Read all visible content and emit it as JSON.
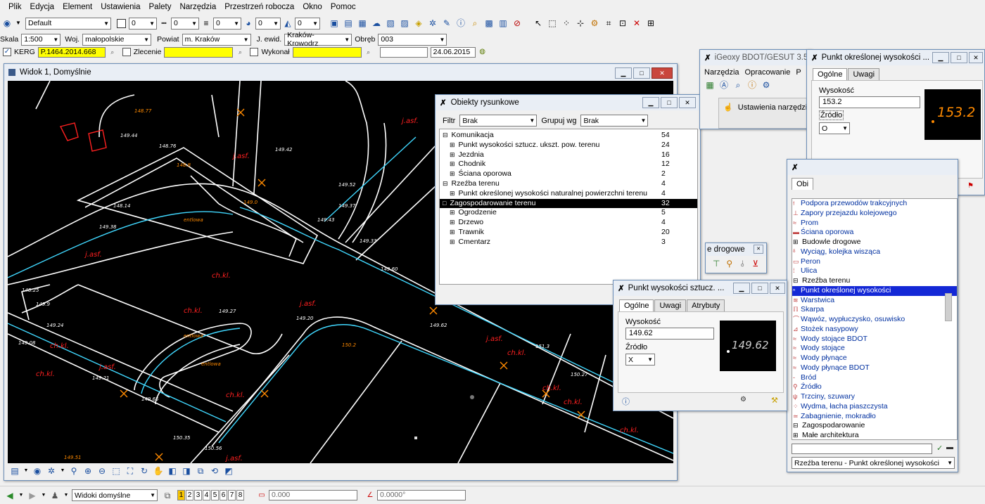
{
  "menu": [
    "Plik",
    "Edycja",
    "Element",
    "Ustawienia",
    "Palety",
    "Narzędzia",
    "Przestrzeń robocza",
    "Okno",
    "Pomoc"
  ],
  "toolbar1": {
    "style_combo": "Default",
    "color_val": "0",
    "weight_val": "0",
    "level_val": "0",
    "fill_val": "0",
    "trans_val": "0"
  },
  "toolbar2": {
    "skala_label": "Skala",
    "skala_value": "1:500",
    "woj_label": "Woj.",
    "woj_value": "małopolskie",
    "powiat_label": "Powiat",
    "powiat_value": "m. Kraków",
    "jewid_label": "J. ewid.",
    "jewid_value": "Kraków-Krowodrz",
    "obreb_label": "Obręb",
    "obreb_value": "003"
  },
  "toolbar3": {
    "kerg_label": "KERG",
    "kerg_value": "P.1464.2014.668",
    "zlecenie_label": "Zlecenie",
    "zlecenie_value": "",
    "wykonal_label": "Wykonał",
    "wykonal_value": "",
    "blank_value": "",
    "date_value": "24.06.2015"
  },
  "view_window": {
    "title": "Widok 1, Domyślnie"
  },
  "map_labels": {
    "heights": [
      "149.62",
      "149.0",
      "149.51",
      "149.44",
      "149.42",
      "149.43",
      "149.37",
      "149.33",
      "149.9",
      "148.8",
      "149.24",
      "149.27",
      "149.20",
      "149.60",
      "150.2",
      "151.3",
      "150.27",
      "150.35",
      "150.56",
      "149.62",
      "149.52",
      "149.21",
      "149.65",
      "148.14",
      "149.08",
      "148.25",
      "149.38",
      "148.77",
      "148.76"
    ],
    "jezd": [
      "j.asf.",
      "j.asf.",
      "j.asf.",
      "j.asf.",
      "j.asf.",
      "j.asf.",
      "j.asf."
    ],
    "chodnik": [
      "ch.kl.",
      "ch.kl.",
      "ch.kl.",
      "ch.kl.",
      "ch.kl.",
      "ch.kl.",
      "ch.kl.",
      "ch.kl.",
      "ch.kl."
    ],
    "entries": [
      "entlowa",
      "entlowa",
      "entlowa"
    ]
  },
  "obiekty": {
    "title": "Obiekty rysunkowe",
    "filtr_label": "Filtr",
    "filtr_value": "Brak",
    "grupuj_label": "Grupuj wg",
    "grupuj_value": "Brak",
    "rows": [
      {
        "label": "Komunikacja",
        "count": "54",
        "level": 0,
        "sel": false
      },
      {
        "label": "Punkt wysokości sztucz. ukszt. pow. terenu",
        "count": "24",
        "level": 1,
        "sel": false
      },
      {
        "label": "Jezdnia",
        "count": "16",
        "level": 1,
        "sel": false
      },
      {
        "label": "Chodnik",
        "count": "12",
        "level": 1,
        "sel": false
      },
      {
        "label": "Ściana oporowa",
        "count": "2",
        "level": 1,
        "sel": false
      },
      {
        "label": "Rzeźba terenu",
        "count": "4",
        "level": 0,
        "sel": false
      },
      {
        "label": "Punkt określonej wysokości naturalnej powierzchni terenu",
        "count": "4",
        "level": 1,
        "sel": false
      },
      {
        "label": "Zagospodarowanie terenu",
        "count": "32",
        "level": 0,
        "sel": true
      },
      {
        "label": "Ogrodzenie",
        "count": "5",
        "level": 1,
        "sel": false
      },
      {
        "label": "Drzewo",
        "count": "4",
        "level": 1,
        "sel": false
      },
      {
        "label": "Trawnik",
        "count": "20",
        "level": 1,
        "sel": false
      },
      {
        "label": "Cmentarz",
        "count": "3",
        "level": 1,
        "sel": false
      }
    ]
  },
  "punkt_sztuczny": {
    "title": "Punkt wysokości sztucz. ...",
    "tabs": [
      "Ogólne",
      "Uwagi",
      "Atrybuty"
    ],
    "wys_label": "Wysokość",
    "wys_value": "149.62",
    "zrodlo_label": "Źródło",
    "zrodlo_value": "X",
    "preview": "149.62"
  },
  "punkt_okreslony": {
    "title": "Punkt określonej wysokości ...",
    "tabs": [
      "Ogólne",
      "Uwagi"
    ],
    "wys_label": "Wysokość",
    "wys_value": "153.2",
    "zrodlo_label": "Źródło",
    "zrodlo_value": "O",
    "preview": "153.2"
  },
  "igeoxy": {
    "title": "iGeoxy BDOT/GESUT 3.54.2",
    "menu": [
      "Narzędzia",
      "Opracowanie",
      "P"
    ],
    "ustawienia": "Ustawienia narzędzi"
  },
  "drogowe_palette": {
    "title": "e drogowe"
  },
  "symbol_window": {
    "tab_label": "Obi",
    "items": [
      {
        "label": "Podpora przewodów trakcyjnych",
        "type": "item",
        "icon": "⟊"
      },
      {
        "label": "Zapory przejazdu kolejowego",
        "type": "item",
        "icon": "⊥"
      },
      {
        "label": "Prom",
        "type": "item",
        "icon": "≈"
      },
      {
        "label": "Ściana oporowa",
        "type": "item",
        "icon": "▬"
      },
      {
        "label": "Budowle drogowe",
        "type": "cat",
        "icon": "⊞"
      },
      {
        "label": "Wyciąg, kolejka wisząca",
        "type": "item",
        "icon": "ᵟ"
      },
      {
        "label": "Peron",
        "type": "item",
        "icon": "▭"
      },
      {
        "label": "Ulica",
        "type": "item",
        "icon": "⁞"
      },
      {
        "label": "Rzeźba terenu",
        "type": "cat",
        "icon": "⊟"
      },
      {
        "label": "Punkt określonej wysokości",
        "type": "sel",
        "icon": "ⁿ"
      },
      {
        "label": "Warstwica",
        "type": "item",
        "icon": "≋"
      },
      {
        "label": "Skarpa",
        "type": "item",
        "icon": "ℿ"
      },
      {
        "label": "Wąwóz, wypłuczysko, osuwisko",
        "type": "item",
        "icon": "⌒"
      },
      {
        "label": "Stożek nasypowy",
        "type": "item",
        "icon": "⊿"
      },
      {
        "label": "Wody stojące BDOT",
        "type": "item",
        "icon": "≈"
      },
      {
        "label": "Wody stojące",
        "type": "item",
        "icon": "≈"
      },
      {
        "label": "Wody płynące",
        "type": "item",
        "icon": "≈"
      },
      {
        "label": "Wody płynące BDOT",
        "type": "item",
        "icon": "≈"
      },
      {
        "label": "Bród",
        "type": "item",
        "icon": "-"
      },
      {
        "label": "Źródło",
        "type": "item",
        "icon": "⚲"
      },
      {
        "label": "Trzciny, szuwary",
        "type": "item",
        "icon": "ψ"
      },
      {
        "label": "Wydma, łacha piaszczysta",
        "type": "item",
        "icon": "⁘"
      },
      {
        "label": "Zabagnienie, mokradło",
        "type": "item",
        "icon": "≃"
      },
      {
        "label": "Zagospodarowanie",
        "type": "cat",
        "icon": "⊟"
      },
      {
        "label": "Małe architektura",
        "type": "cat",
        "icon": "⊞"
      }
    ],
    "search_value": "",
    "bottom_combo": "Rzeźba terenu - Punkt określonej wysokości"
  },
  "statusbar": {
    "views_combo": "Widoki domyślne",
    "pages": [
      "1",
      "2",
      "3",
      "4",
      "5",
      "6",
      "7",
      "8"
    ],
    "active_page": "1",
    "coord1": "0.000",
    "coord2": "0.0000°"
  }
}
